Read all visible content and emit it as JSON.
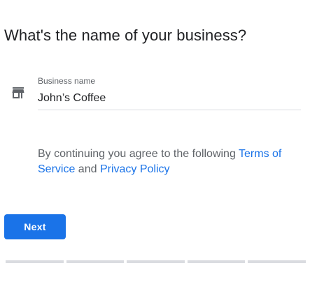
{
  "page": {
    "title": "What's the name of your business?"
  },
  "business_field": {
    "label": "Business name",
    "value": "John’s Coffee",
    "icon": "store-icon"
  },
  "terms": {
    "prefix": "By continuing you agree to the following ",
    "terms_link": "Terms of Service",
    "connector": " and ",
    "privacy_link": "Privacy Policy"
  },
  "actions": {
    "next_label": "Next"
  },
  "progress": {
    "total_steps": 5,
    "completed_steps": 0
  },
  "colors": {
    "accent": "#1a73e8",
    "text_primary": "#202124",
    "text_secondary": "#5f6368",
    "divider": "#dadce0"
  }
}
